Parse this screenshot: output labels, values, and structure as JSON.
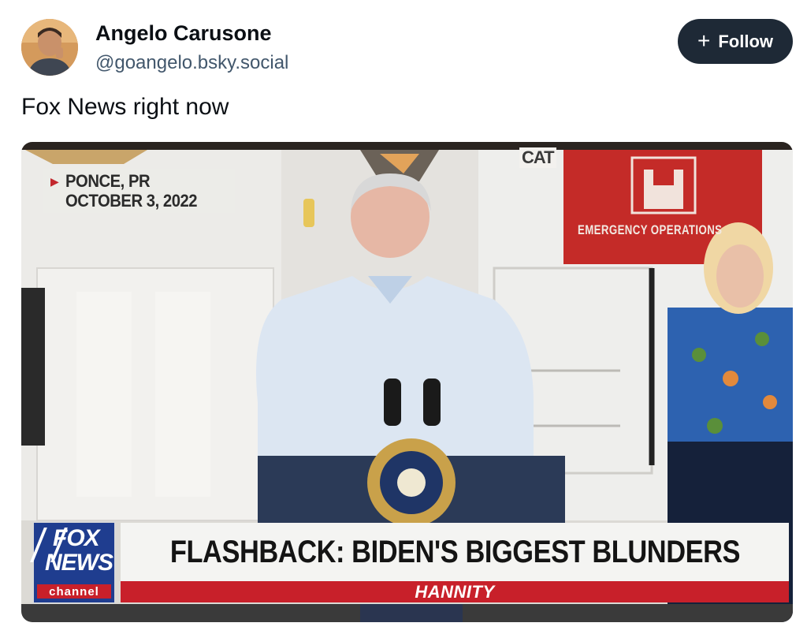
{
  "author": {
    "name": "Angelo Carusone",
    "handle": "@goangelo.bsky.social"
  },
  "follow_button": {
    "label": "Follow",
    "icon": "plus-icon"
  },
  "post": {
    "text": "Fox News right now"
  },
  "media": {
    "location_line1": "PONCE, PR",
    "location_line2": "OCTOBER 3, 2022",
    "headline": "FLASHBACK: BIDEN'S BIGGEST BLUNDERS",
    "show_name": "HANNITY",
    "logo_line1": "FOX",
    "logo_line2": "NEWS",
    "logo_line3": "channel",
    "background_sign": "EMERGENCY OPERATIONS",
    "background_logo": "CAT"
  },
  "colors": {
    "follow_bg": "#1e2936",
    "banner_red": "#c8202a",
    "fox_blue": "#1f3d8f",
    "sign_red": "#c42b28"
  }
}
